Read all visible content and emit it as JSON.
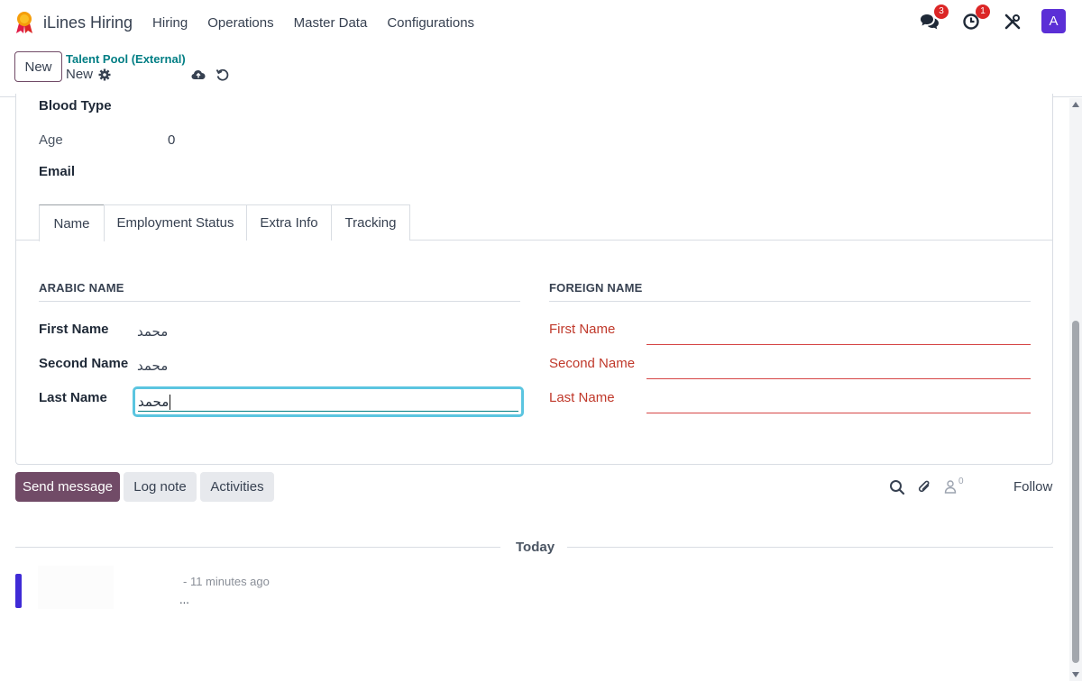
{
  "navbar": {
    "app_name": "iLines Hiring",
    "menu": [
      "Hiring",
      "Operations",
      "Master Data",
      "Configurations"
    ],
    "messages_badge": "3",
    "activities_badge": "1",
    "avatar_letter": "A"
  },
  "control_panel": {
    "new_label": "New",
    "breadcrumb_parent": "Talent Pool (External)",
    "breadcrumb_current": "New"
  },
  "form": {
    "blood_type_label": "Blood Type",
    "age_label": "Age",
    "age_value": "0",
    "email_label": "Email"
  },
  "tabs": [
    "Name",
    "Employment Status",
    "Extra Info",
    "Tracking"
  ],
  "arabic_name": {
    "title": "ARABIC NAME",
    "first_label": "First Name",
    "first_value": "محمد",
    "second_label": "Second Name",
    "second_value": "محمد",
    "last_label": "Last Name",
    "last_value": "محمد"
  },
  "foreign_name": {
    "title": "FOREIGN NAME",
    "first_label": "First Name",
    "second_label": "Second Name",
    "last_label": "Last Name"
  },
  "chatter": {
    "send_message": "Send message",
    "log_note": "Log note",
    "activities": "Activities",
    "followers_count": "0",
    "follow": "Follow",
    "today": "Today",
    "msg_time": "- 11 minutes ago",
    "msg_body": "..."
  },
  "colors": {
    "primary": "#714b67",
    "teal": "#017e84",
    "invalid": "#d64545",
    "focus": "#5bc5e0",
    "avatar": "#5b2fd6"
  }
}
